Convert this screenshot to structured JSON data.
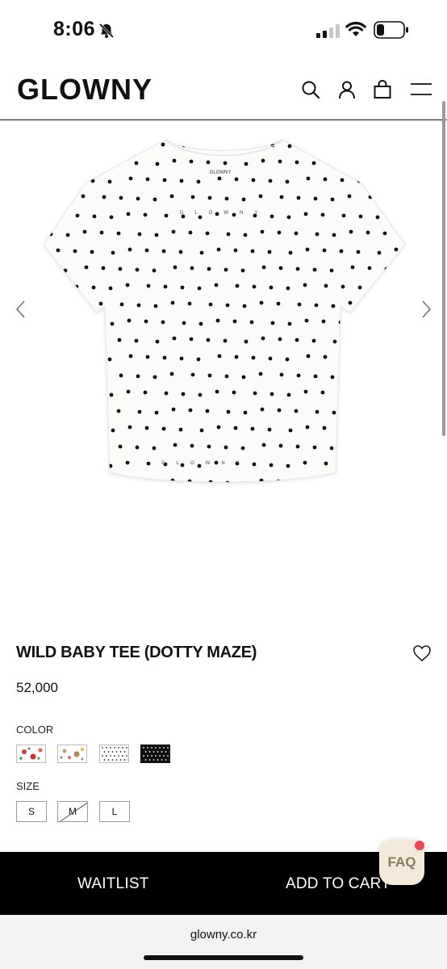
{
  "status_bar": {
    "time": "8:06"
  },
  "header": {
    "logo": "GLOWNY"
  },
  "product": {
    "title": "WILD BABY TEE (DOTTY MAZE)",
    "price": "52,000",
    "shirt_print": "GLOWNY",
    "neck_label": "GLOWNY"
  },
  "options": {
    "color_label": "COLOR",
    "size_label": "SIZE",
    "sizes": [
      {
        "label": "S",
        "available": true
      },
      {
        "label": "M",
        "available": false
      },
      {
        "label": "L",
        "available": true
      }
    ]
  },
  "actions": {
    "waitlist": "WAITLIST",
    "add_to_cart": "ADD TO CART",
    "faq": "FAQ"
  },
  "browser": {
    "url": "glowny.co.kr"
  }
}
